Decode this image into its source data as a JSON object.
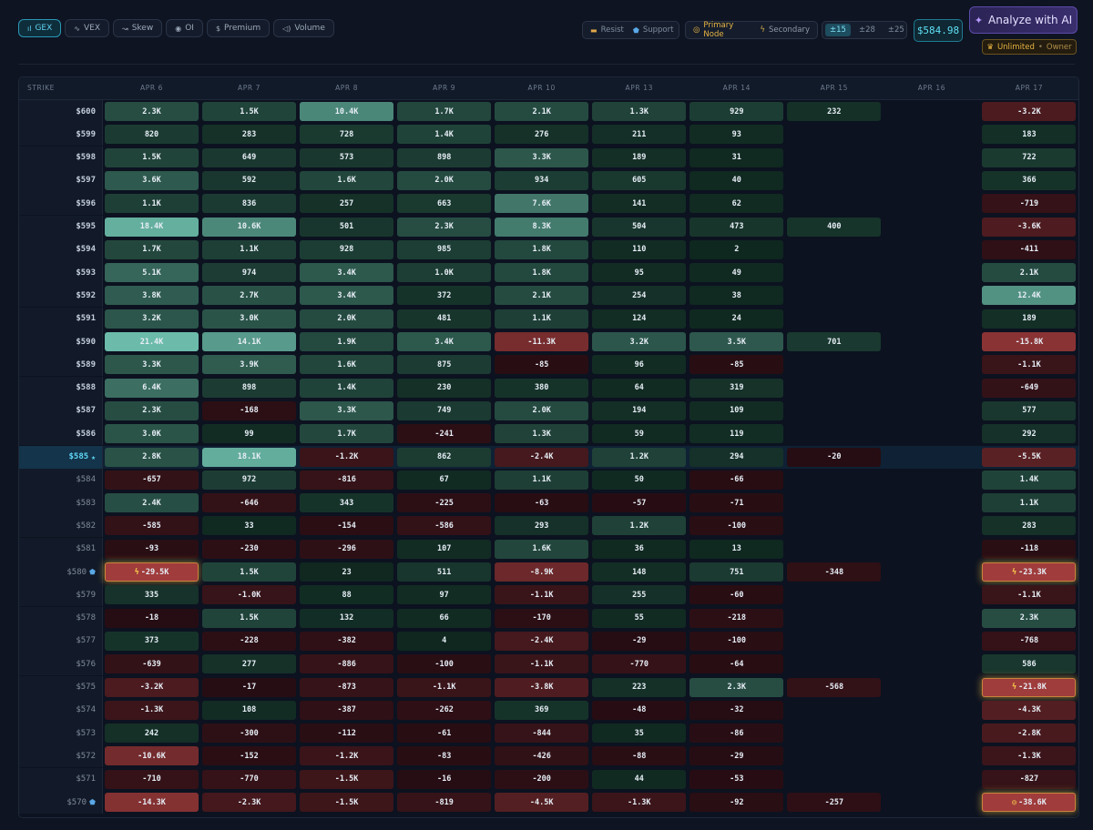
{
  "tabs": [
    {
      "label": "GEX",
      "icon": "bar-chart-icon",
      "glyph": "ıl",
      "active": true
    },
    {
      "label": "VEX",
      "icon": "activity-icon",
      "glyph": "∿",
      "active": false
    },
    {
      "label": "Skew",
      "icon": "trend-icon",
      "glyph": "↝",
      "active": false
    },
    {
      "label": "OI",
      "icon": "eye-icon",
      "glyph": "◉",
      "active": false
    },
    {
      "label": "Premium",
      "icon": "dollar-icon",
      "glyph": "$",
      "active": false
    },
    {
      "label": "Volume",
      "icon": "speaker-icon",
      "glyph": "◁)",
      "active": false
    }
  ],
  "legend": {
    "resist": "Resist",
    "support": "Support",
    "primary": "Primary Node",
    "secondary": "Secondary"
  },
  "ranges": [
    {
      "label": "±15",
      "active": true
    },
    {
      "label": "±28",
      "active": false
    },
    {
      "label": "±25",
      "active": false
    }
  ],
  "price": "$584.98",
  "ai_button": "Analyze with AI",
  "badge": {
    "plan": "Unlimited",
    "role": "Owner"
  },
  "grid": {
    "strike_header": "STRIKE",
    "dates": [
      "APR 6",
      "APR 7",
      "APR 8",
      "APR 9",
      "APR 10",
      "APR 13",
      "APR 14",
      "APR 15",
      "APR 16",
      "APR 17"
    ],
    "rows": [
      {
        "strike": "$600",
        "cells": [
          "2.3K",
          "1.5K",
          "10.4K",
          "1.7K",
          "2.1K",
          "1.3K",
          "929",
          "232",
          "",
          "-3.2K"
        ]
      },
      {
        "strike": "$599",
        "cells": [
          "820",
          "283",
          "728",
          "1.4K",
          "276",
          "211",
          "93",
          "",
          "",
          "183"
        ]
      },
      {
        "strike": "$598",
        "cells": [
          "1.5K",
          "649",
          "573",
          "898",
          "3.3K",
          "189",
          "31",
          "",
          "",
          "722"
        ]
      },
      {
        "strike": "$597",
        "cells": [
          "3.6K",
          "592",
          "1.6K",
          "2.0K",
          "934",
          "605",
          "40",
          "",
          "",
          "366"
        ]
      },
      {
        "strike": "$596",
        "cells": [
          "1.1K",
          "836",
          "257",
          "663",
          "7.6K",
          "141",
          "62",
          "",
          "",
          "-719"
        ]
      },
      {
        "strike": "$595",
        "cells": [
          "18.4K",
          "10.6K",
          "501",
          "2.3K",
          "8.3K",
          "504",
          "473",
          "400",
          "",
          "-3.6K"
        ]
      },
      {
        "strike": "$594",
        "cells": [
          "1.7K",
          "1.1K",
          "928",
          "985",
          "1.8K",
          "110",
          "2",
          "",
          "",
          "-411"
        ]
      },
      {
        "strike": "$593",
        "cells": [
          "5.1K",
          "974",
          "3.4K",
          "1.0K",
          "1.8K",
          "95",
          "49",
          "",
          "",
          "2.1K"
        ]
      },
      {
        "strike": "$592",
        "cells": [
          "3.8K",
          "2.7K",
          "3.4K",
          "372",
          "2.1K",
          "254",
          "38",
          "",
          "",
          "12.4K"
        ]
      },
      {
        "strike": "$591",
        "cells": [
          "3.2K",
          "3.0K",
          "2.0K",
          "481",
          "1.1K",
          "124",
          "24",
          "",
          "",
          "189"
        ]
      },
      {
        "strike": "$590",
        "cells": [
          "21.4K",
          "14.1K",
          "1.9K",
          "3.4K",
          "-11.3K",
          "3.2K",
          "3.5K",
          "701",
          "",
          "-15.8K"
        ]
      },
      {
        "strike": "$589",
        "cells": [
          "3.3K",
          "3.9K",
          "1.6K",
          "875",
          "-85",
          "96",
          "-85",
          "",
          "",
          "-1.1K"
        ]
      },
      {
        "strike": "$588",
        "cells": [
          "6.4K",
          "898",
          "1.4K",
          "230",
          "380",
          "64",
          "319",
          "",
          "",
          "-649"
        ]
      },
      {
        "strike": "$587",
        "cells": [
          "2.3K",
          "-168",
          "3.3K",
          "749",
          "2.0K",
          "194",
          "109",
          "",
          "",
          "577"
        ]
      },
      {
        "strike": "$586",
        "cells": [
          "3.0K",
          "99",
          "1.7K",
          "-241",
          "1.3K",
          "59",
          "119",
          "",
          "",
          "292"
        ]
      },
      {
        "strike": "$585",
        "cells": [
          "2.8K",
          "18.1K",
          "-1.2K",
          "862",
          "-2.4K",
          "1.2K",
          "294",
          "-20",
          "",
          "-5.5K"
        ]
      },
      {
        "strike": "$584",
        "cells": [
          "-657",
          "972",
          "-816",
          "67",
          "1.1K",
          "50",
          "-66",
          "",
          "",
          "1.4K"
        ]
      },
      {
        "strike": "$583",
        "cells": [
          "2.4K",
          "-646",
          "343",
          "-225",
          "-63",
          "-57",
          "-71",
          "",
          "",
          "1.1K"
        ]
      },
      {
        "strike": "$582",
        "cells": [
          "-585",
          "33",
          "-154",
          "-586",
          "293",
          "1.2K",
          "-100",
          "",
          "",
          "283"
        ]
      },
      {
        "strike": "$581",
        "cells": [
          "-93",
          "-230",
          "-296",
          "107",
          "1.6K",
          "36",
          "13",
          "",
          "",
          "-118"
        ]
      },
      {
        "strike": "$580",
        "cells": [
          "-29.5K",
          "1.5K",
          "23",
          "511",
          "-8.9K",
          "148",
          "751",
          "-348",
          "",
          "-23.3K"
        ]
      },
      {
        "strike": "$579",
        "cells": [
          "335",
          "-1.0K",
          "88",
          "97",
          "-1.1K",
          "255",
          "-60",
          "",
          "",
          "-1.1K"
        ]
      },
      {
        "strike": "$578",
        "cells": [
          "-18",
          "1.5K",
          "132",
          "66",
          "-170",
          "55",
          "-218",
          "",
          "",
          "2.3K"
        ]
      },
      {
        "strike": "$577",
        "cells": [
          "373",
          "-228",
          "-382",
          "4",
          "-2.4K",
          "-29",
          "-100",
          "",
          "",
          "-768"
        ]
      },
      {
        "strike": "$576",
        "cells": [
          "-639",
          "277",
          "-886",
          "-100",
          "-1.1K",
          "-770",
          "-64",
          "",
          "",
          "586"
        ]
      },
      {
        "strike": "$575",
        "cells": [
          "-3.2K",
          "-17",
          "-873",
          "-1.1K",
          "-3.8K",
          "223",
          "2.3K",
          "-568",
          "",
          "-21.8K"
        ]
      },
      {
        "strike": "$574",
        "cells": [
          "-1.3K",
          "108",
          "-387",
          "-262",
          "369",
          "-48",
          "-32",
          "",
          "",
          "-4.3K"
        ]
      },
      {
        "strike": "$573",
        "cells": [
          "242",
          "-300",
          "-112",
          "-61",
          "-844",
          "35",
          "-86",
          "",
          "",
          "-2.8K"
        ]
      },
      {
        "strike": "$572",
        "cells": [
          "-10.6K",
          "-152",
          "-1.2K",
          "-83",
          "-426",
          "-88",
          "-29",
          "",
          "",
          "-1.3K"
        ]
      },
      {
        "strike": "$571",
        "cells": [
          "-710",
          "-770",
          "-1.5K",
          "-16",
          "-200",
          "44",
          "-53",
          "",
          "",
          "-827"
        ]
      },
      {
        "strike": "$570",
        "cells": [
          "-14.3K",
          "-2.3K",
          "-1.5K",
          "-819",
          "-4.5K",
          "-1.3K",
          "-92",
          "-257",
          "",
          "-38.6K"
        ]
      }
    ],
    "current_strike": "$585",
    "support_strikes": [
      "$580",
      "$570"
    ],
    "nodes": [
      {
        "strike": "$580",
        "col": 0,
        "kind": "bolt"
      },
      {
        "strike": "$580",
        "col": 9,
        "kind": "bolt"
      },
      {
        "strike": "$575",
        "col": 9,
        "kind": "bolt"
      },
      {
        "strike": "$570",
        "col": 9,
        "kind": "primary"
      }
    ]
  }
}
